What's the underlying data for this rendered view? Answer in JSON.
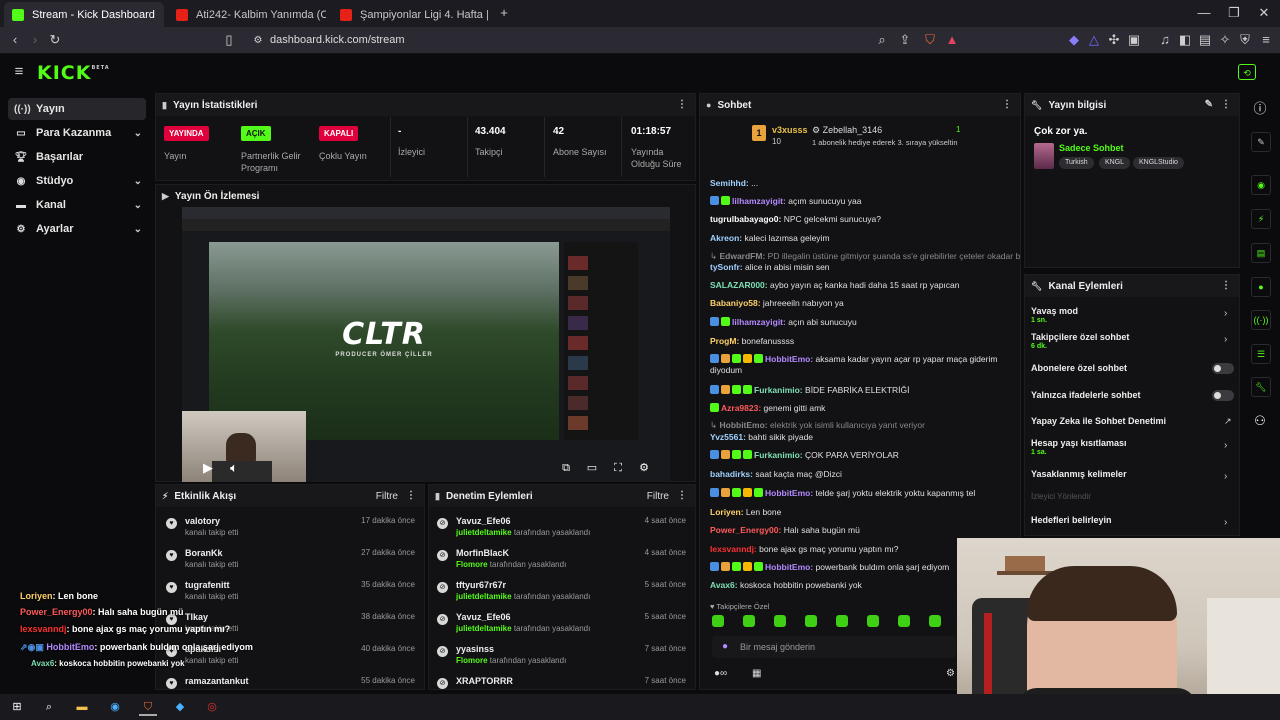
{
  "browser": {
    "tabs": [
      {
        "title": "Stream - Kick Dashboard",
        "fav": "#53fc18"
      },
      {
        "title": "Ati242- Kalbim Yanımda (Official Vide",
        "fav": "#e62117"
      },
      {
        "title": "Şampiyonlar Ligi 4. Hafta | Ajax - Gala",
        "fav": "#e62117"
      }
    ],
    "new_tab": "+",
    "url": "dashboard.kick.com/stream"
  },
  "kick": {
    "logo": "KICK",
    "beta": "BETA"
  },
  "sidebar": {
    "items": [
      {
        "label": "Yayın",
        "icon": "broadcast-icon",
        "active": true,
        "chev": false
      },
      {
        "label": "Para Kazanma",
        "icon": "money-icon",
        "chev": true
      },
      {
        "label": "Başarılar",
        "icon": "trophy-icon",
        "chev": false
      },
      {
        "label": "Stüdyo",
        "icon": "studio-icon",
        "chev": true
      },
      {
        "label": "Kanal",
        "icon": "channel-icon",
        "chev": true
      },
      {
        "label": "Ayarlar",
        "icon": "gear-icon",
        "chev": true
      }
    ]
  },
  "stats": {
    "title": "Yayın İstatistikleri",
    "items": [
      {
        "badge": "YAYINDA",
        "badge_color": "#e0003c",
        "label": "Yayın"
      },
      {
        "badge": "AÇIK",
        "badge_color": "#53fc18",
        "label": "Partnerlik Gelir Programı"
      },
      {
        "badge": "KAPALI",
        "badge_color": "#e0003c",
        "label": "Çoklu Yayın"
      }
    ],
    "values": [
      {
        "value": "-",
        "label": "İzleyici"
      },
      {
        "value": "43.404",
        "label": "Takipçi"
      },
      {
        "value": "42",
        "label": "Abone Sayısı"
      },
      {
        "value": "01:18:57",
        "label": "Yayında Olduğu Süre"
      }
    ]
  },
  "preview": {
    "title": "Yayın Ön İzlemesi",
    "video_text": "CLTR",
    "video_sub": "PRODUCER ÖMER ÇİLLER"
  },
  "activity": {
    "title": "Etkinlik Akışı",
    "filter": "Filtre",
    "rows": [
      {
        "name": "valotory",
        "sub": "kanalı takip etti",
        "time": "17 dakika önce"
      },
      {
        "name": "BoranKk",
        "sub": "kanalı takip etti",
        "time": "27 dakika önce"
      },
      {
        "name": "tugrafenitt",
        "sub": "kanalı takip etti",
        "time": "35 dakika önce"
      },
      {
        "name": "Tlkay",
        "sub": "kanalı takip etti",
        "time": "38 dakika önce"
      },
      {
        "name": "apakdisi",
        "sub": "kanalı takip etti",
        "time": "40 dakika önce"
      },
      {
        "name": "ramazantankut",
        "sub": "",
        "time": "55 dakika önce"
      }
    ]
  },
  "moderation": {
    "title": "Denetim Eylemleri",
    "filter": "Filtre",
    "rows": [
      {
        "name": "Yavuz_Efe06",
        "by": "julietdeltamike",
        "sub": "tarafından yasaklandı",
        "time": "4 saat önce"
      },
      {
        "name": "MorfinBlacK",
        "by": "Flomore",
        "sub": "tarafından yasaklandı",
        "time": "4 saat önce"
      },
      {
        "name": "tftyur67r67r",
        "by": "julietdeltamike",
        "sub": "tarafından yasaklandı",
        "time": "5 saat önce"
      },
      {
        "name": "Yavuz_Efe06",
        "by": "julietdeltamike",
        "sub": "tarafından yasaklandı",
        "time": "5 saat önce"
      },
      {
        "name": "yyasinss",
        "by": "Flomore",
        "sub": "tarafından yasaklandı",
        "time": "7 saat önce"
      },
      {
        "name": "XRAPTORRR",
        "by": "",
        "sub": "",
        "time": "7 saat önce"
      }
    ]
  },
  "chat": {
    "title": "Sohbet",
    "pinned": {
      "user": "v3xusss",
      "count": "10",
      "gifter": "Zebellah_3146",
      "gift_count": "1",
      "text": "1 abonelik hediye ederek 3. sıraya yükseltin"
    },
    "messages": [
      {
        "user": "Semihhd:",
        "color": "#9fd2ff",
        "text": "...",
        "badges": []
      },
      {
        "user": "lilhamzayigit:",
        "color": "#b58aff",
        "text": "açım sunucuyu yaa",
        "badges": [
          "#4a90e2",
          "#53fc18"
        ]
      },
      {
        "user": "tugrulbabayago0:",
        "color": "#ffffff",
        "text": "NPC gelcekmi sunucuya?",
        "badges": []
      },
      {
        "user": "Akreon:",
        "color": "#9fd2ff",
        "text": "kaleci lazımsa geleyim",
        "badges": []
      },
      {
        "user": "EdwardFM:",
        "color": "#888888",
        "text": "PD illegalin üstüne gitmiyor şuanda ss'e girebilirler çeteler okadar büy...",
        "badges": [],
        "reply": true
      },
      {
        "user": "tySonfr:",
        "color": "#9fd2ff",
        "text": "alice in abisi misin sen",
        "badges": []
      },
      {
        "user": "SALAZAR000:",
        "color": "#7ee0b5",
        "text": "aybo yayın aç kanka hadi daha 15 saat rp yapıcan",
        "badges": []
      },
      {
        "user": "Babaniyo58:",
        "color": "#ffd36a",
        "text": "jahreeeiln nabıyon ya",
        "badges": []
      },
      {
        "user": "lilhamzayigit:",
        "color": "#b58aff",
        "text": "açın abi sunucuyu",
        "badges": [
          "#4a90e2",
          "#53fc18"
        ]
      },
      {
        "user": "ProgM:",
        "color": "#ffd36a",
        "text": "bonefanussss",
        "badges": []
      },
      {
        "user": "HobbitEmo:",
        "color": "#b58aff",
        "text": "aksama kadar yayın açar rp yapar maça giderim diyodum",
        "badges": [
          "#4a90e2",
          "#e8a33d",
          "#53fc18",
          "#f5b700",
          "#53fc18"
        ]
      },
      {
        "user": "Furkanimio:",
        "color": "#7ee0b5",
        "text": "BİDE FABRİKA ELEKTRİĞİ",
        "badges": [
          "#4a90e2",
          "#e8a33d",
          "#53fc18",
          "#53fc18"
        ]
      },
      {
        "user": "Azra9823:",
        "color": "#ff5a5a",
        "text": "genemi gitti amk",
        "badges": [
          "#53fc18"
        ]
      },
      {
        "user": "HobbitEmo:",
        "color": "#888888",
        "text": "elektrik yok isimli kullanıcıya yanıt veriyor",
        "badges": [],
        "reply": true
      },
      {
        "user": "Yvz5561:",
        "color": "#9fd2ff",
        "text": "bahti sikik piyade",
        "badges": []
      },
      {
        "user": "Furkanimio:",
        "color": "#7ee0b5",
        "text": "ÇOK PARA VERİYOLAR",
        "badges": [
          "#4a90e2",
          "#e8a33d",
          "#53fc18",
          "#53fc18"
        ]
      },
      {
        "user": "bahadirks:",
        "color": "#9fd2ff",
        "text": "saat kaçta maç @Dizci",
        "badges": []
      },
      {
        "user": "HobbitEmo:",
        "color": "#b58aff",
        "text": "telde şarj yoktu elektrik yoktu kapanmış tel",
        "badges": [
          "#4a90e2",
          "#e8a33d",
          "#53fc18",
          "#f5b700",
          "#53fc18"
        ]
      },
      {
        "user": "Loriyen:",
        "color": "#ffd36a",
        "text": "Len bone",
        "badges": []
      },
      {
        "user": "Power_Energy00:",
        "color": "#ff5a5a",
        "text": "Halı saha bugün mü",
        "badges": []
      },
      {
        "user": "lexsvanndj:",
        "color": "#ff3030",
        "text": "bone ajax gs maç yorumu yaptın mı?",
        "badges": []
      },
      {
        "user": "HobbitEmo:",
        "color": "#b58aff",
        "text": "powerbank buldım onla şarj ediyom",
        "badges": [
          "#4a90e2",
          "#e8a33d",
          "#53fc18",
          "#f5b700",
          "#53fc18"
        ]
      },
      {
        "user": "Avax6:",
        "color": "#7ee0b5",
        "text": "koskoca hobbitin powebanki yok",
        "badges": []
      }
    ],
    "followers_only": "Takipçilere Özel",
    "input_placeholder": "Bir mesaj gönderin"
  },
  "stream_info": {
    "title": "Yayın bilgisi",
    "stream_title": "Çok zor ya.",
    "category": "Sadece Sohbet",
    "tags": [
      "Turkish",
      "KNGL",
      "KNGLStudio"
    ]
  },
  "channel_actions": {
    "title": "Kanal Eylemleri",
    "items": [
      {
        "label": "Yavaş mod",
        "sub": "1 sn.",
        "control": "chev"
      },
      {
        "label": "Takipçilere özel sohbet",
        "sub": "6 dk.",
        "control": "chev"
      },
      {
        "label": "Abonelere özel sohbet",
        "sub": "",
        "control": "toggle"
      },
      {
        "label": "Yalnızca ifadelerle sohbet",
        "sub": "",
        "control": "toggle"
      },
      {
        "label": "Yapay Zeka ile Sohbet Denetimi",
        "sub": "",
        "control": "ext"
      },
      {
        "label": "Hesap yaşı kısıtlaması",
        "sub": "1 sa.",
        "control": "chev"
      },
      {
        "label": "Yasaklanmış kelimeler",
        "sub": "",
        "control": "chev"
      },
      {
        "label": "İzleyici Yönlendir",
        "sub": "",
        "control": "none",
        "disabled": true
      },
      {
        "label": "Hedefleri belirleyin",
        "sub": "",
        "control": "chev"
      }
    ]
  },
  "overlay_chat": [
    {
      "user": "Loriyen",
      "color": "#ffd36a",
      "text": ": Len bone"
    },
    {
      "user": "Power_Energy00",
      "color": "#ff5a5a",
      "text": ": Halı saha bugün mü"
    },
    {
      "user": "lexsvanndj",
      "color": "#ff3030",
      "text": ": bone ajax gs maç yorumu yaptın mı?"
    },
    {
      "user": "HobbitEmo",
      "color": "#b58aff",
      "text": ": powerbank buldım onla şarj ediyom"
    },
    {
      "user": "Avax6",
      "color": "#7ee0b5",
      "text": ": koskoca hobbitin powebanki yok"
    }
  ],
  "colors": {
    "accent": "#53fc18",
    "live": "#e0003c"
  }
}
